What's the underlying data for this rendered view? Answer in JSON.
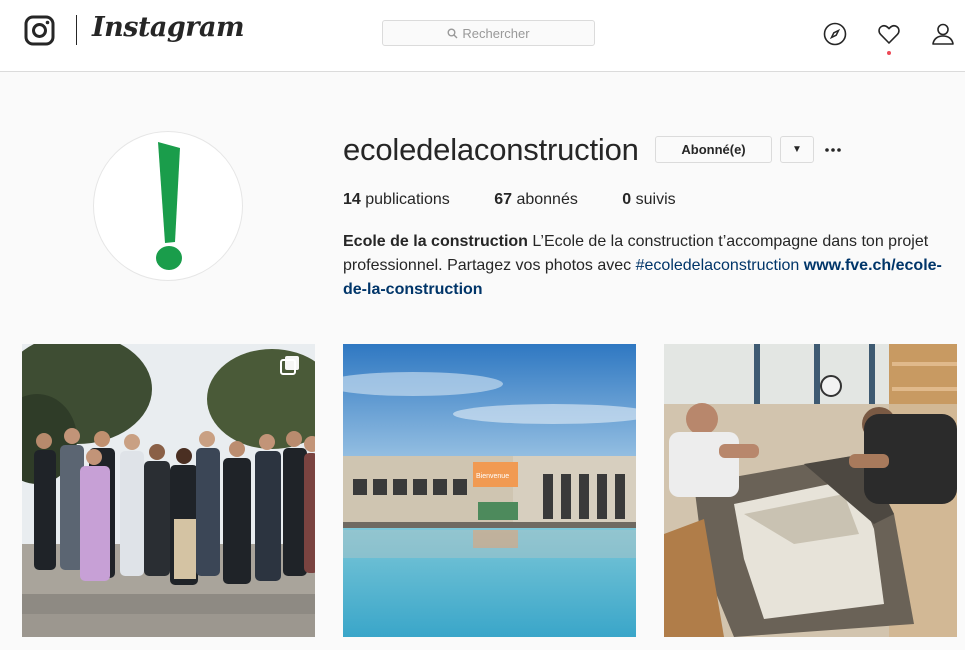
{
  "header": {
    "brand": "Instagram",
    "search_placeholder": "Rechercher",
    "icons": [
      "instagram-logo-icon",
      "search-icon",
      "compass-icon",
      "heart-icon",
      "profile-icon"
    ],
    "has_notification": true
  },
  "profile": {
    "username": "ecoledelaconstruction",
    "follow_label": "Abonné(e)",
    "stats": {
      "posts_count": "14",
      "posts_label": "publications",
      "followers_count": "67",
      "followers_label": "abonnés",
      "following_count": "0",
      "following_label": "suivis"
    },
    "bio": {
      "name": "Ecole de la construction",
      "text": " L’Ecole de la construction t’accompagne dans ton projet professionnel. Partagez vos photos avec ",
      "hashtag": "#ecoledelaconstruction",
      "link": "www.fve.ch/ecole-de-la-construction"
    }
  },
  "posts": [
    {
      "description": "group photo of students outdoors",
      "multi": true
    },
    {
      "description": "building reflected in pool",
      "multi": false,
      "sign_text": "Bienvenue"
    },
    {
      "description": "workers assembling window frame",
      "multi": false
    }
  ],
  "colors": {
    "accent_link": "#003569",
    "notification": "#ed4956",
    "logo_green": "#1a9d4b",
    "border": "#dbdbdb"
  }
}
